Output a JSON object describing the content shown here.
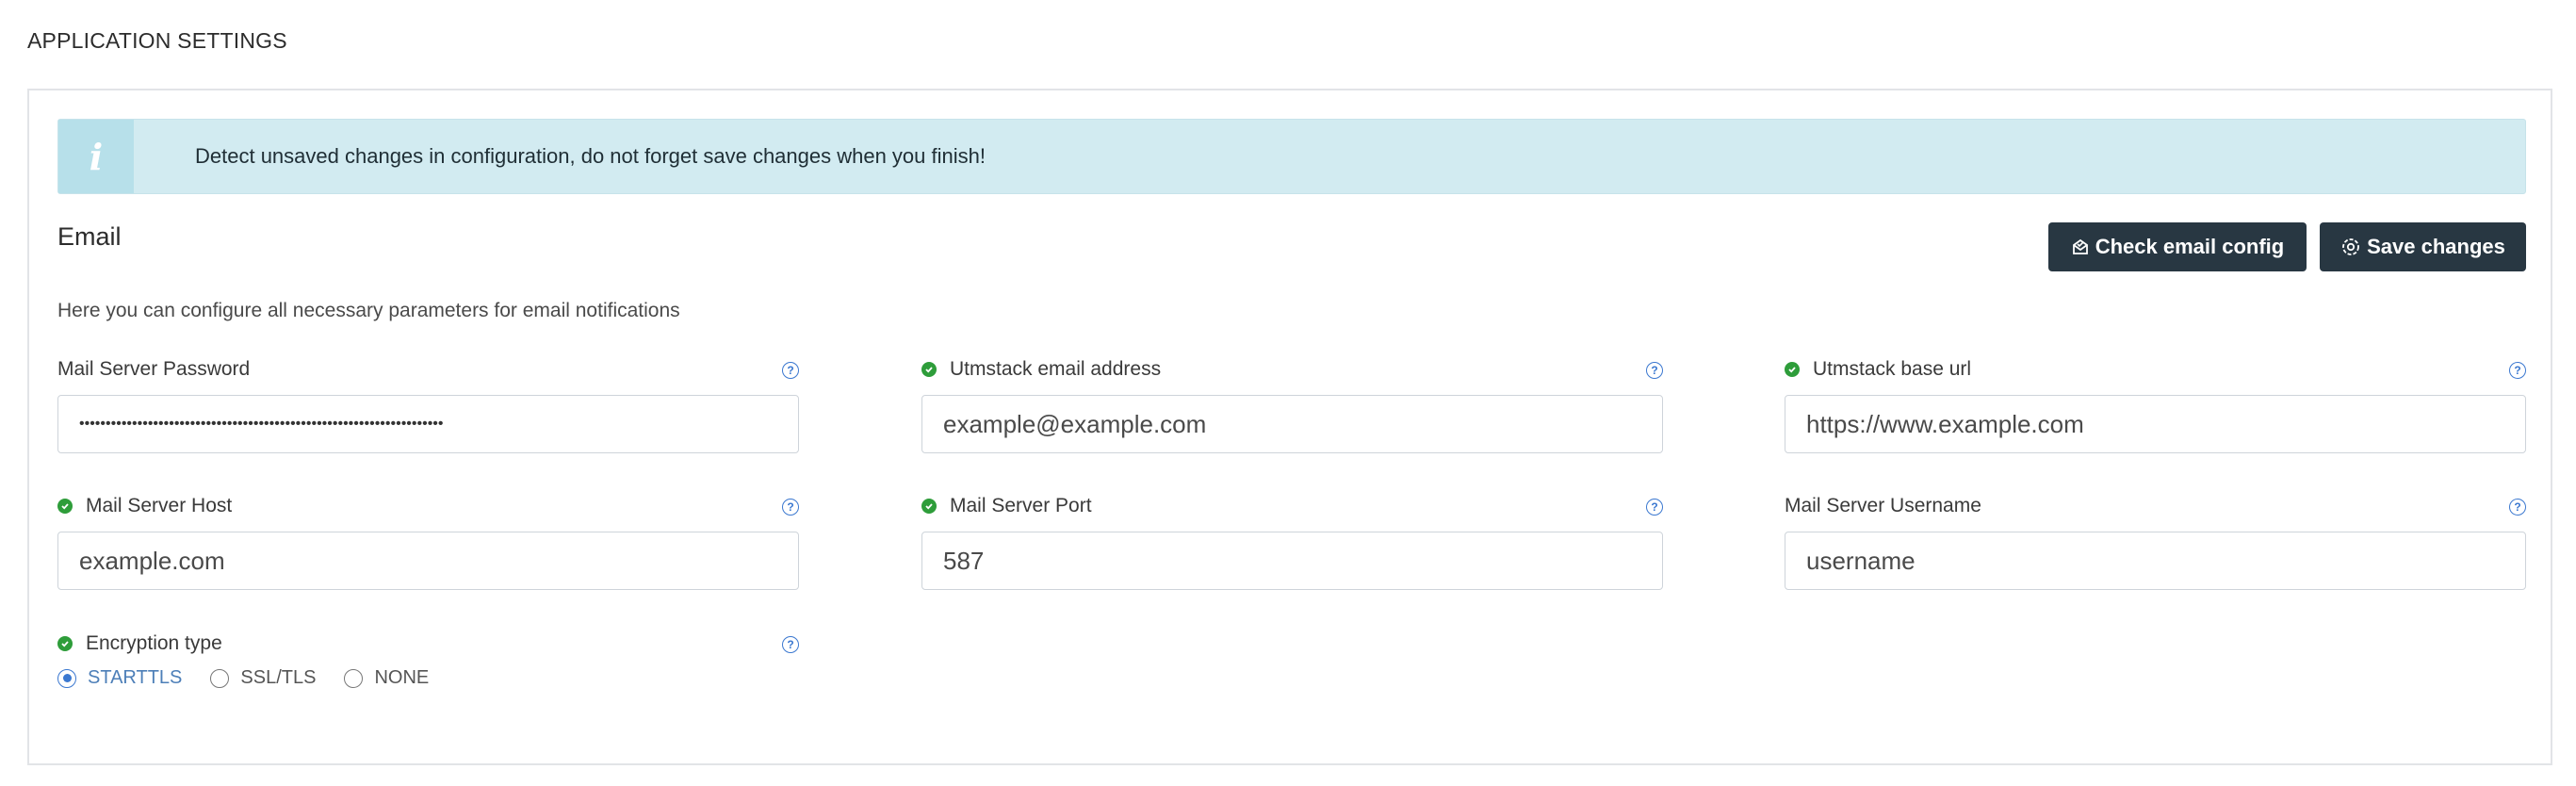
{
  "page": {
    "title": "APPLICATION SETTINGS"
  },
  "alert": {
    "icon": "info-icon",
    "glyph": "i",
    "text": "Detect unsaved changes in configuration, do not forget save changes when you finish!"
  },
  "email": {
    "title": "Email",
    "description": "Here you can configure all necessary parameters for email notifications",
    "buttons": {
      "check_label": "Check email config",
      "save_label": "Save changes"
    },
    "fields": [
      {
        "label": "Mail Server Password",
        "value": "•••••••••••••••••••••••••••••••••••••••••••••••••••••••••••••••••••••",
        "valid": false
      },
      {
        "label": "Utmstack email address",
        "value": "example@example.com",
        "valid": true
      },
      {
        "label": "Utmstack base url",
        "value": "https://www.example.com",
        "valid": true
      },
      {
        "label": "Mail Server Host",
        "value": "example.com",
        "valid": true
      },
      {
        "label": "Mail Server Port",
        "value": "587",
        "valid": true
      },
      {
        "label": "Mail Server Username",
        "value": "username",
        "valid": false
      }
    ],
    "encryption": {
      "label": "Encryption type",
      "valid": true,
      "options": [
        "STARTTLS",
        "SSL/TLS",
        "NONE"
      ],
      "selected": "STARTTLS"
    }
  },
  "colors": {
    "accent": "#3b78d0",
    "button_bg": "#283742",
    "alert_bg": "#d2ebf1",
    "valid": "#2e9d3a"
  }
}
